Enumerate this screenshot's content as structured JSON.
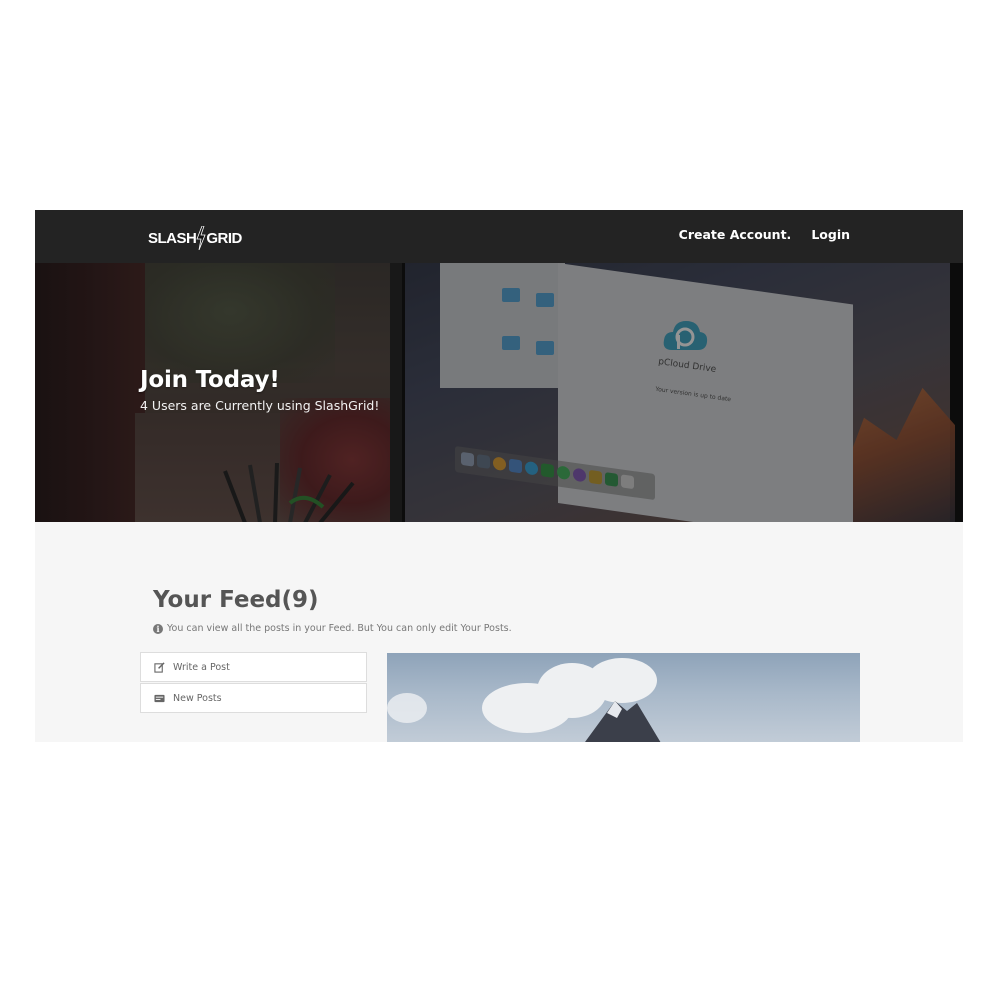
{
  "navbar": {
    "brand_left": "SLASH",
    "brand_right": "GRID",
    "links": [
      {
        "label": "Create Account."
      },
      {
        "label": "Login"
      }
    ]
  },
  "hero": {
    "title": "Join Today!",
    "subtitle": "4 Users are Currently using SlashGrid!",
    "screen_app_name": "pCloud Drive",
    "screen_status": "Your version is up to date"
  },
  "feed": {
    "title": "Your Feed(9)",
    "note": "You can view all the posts in your Feed. But You can only edit Your Posts.",
    "menu": [
      {
        "label": "Write a Post",
        "icon": "edit-icon"
      },
      {
        "label": "New Posts",
        "icon": "list-icon"
      }
    ]
  },
  "colors": {
    "navbar_bg": "#232323",
    "page_bg": "#f6f6f6",
    "feed_title": "#555555"
  }
}
